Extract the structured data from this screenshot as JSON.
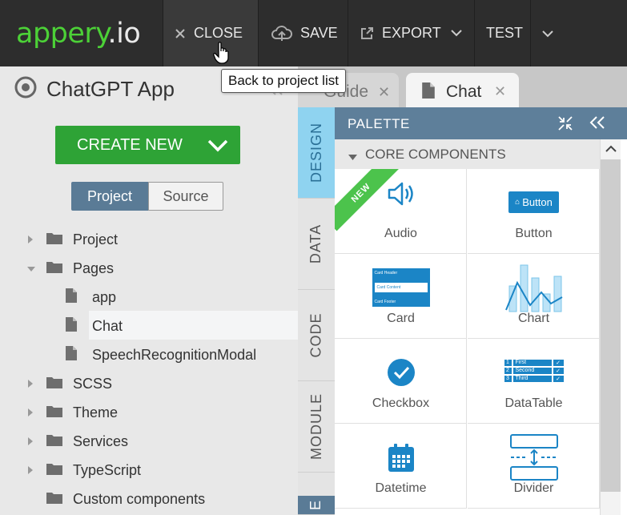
{
  "app": {
    "logo_main": "appery",
    "logo_suffix": ".io",
    "accent": "#4cd137"
  },
  "toolbar": {
    "close_label": "CLOSE",
    "save_label": "SAVE",
    "export_label": "EXPORT",
    "test_label": "TEST"
  },
  "tooltip": {
    "text": "Back to project list"
  },
  "project": {
    "title": "ChatGPT App"
  },
  "create_button": {
    "label": "CREATE NEW"
  },
  "view_toggle": {
    "project": "Project",
    "source": "Source"
  },
  "tree": {
    "items": [
      {
        "label": "Project"
      },
      {
        "label": "Pages"
      },
      {
        "label": "app"
      },
      {
        "label": "Chat"
      },
      {
        "label": "SpeechRecognitionModal"
      },
      {
        "label": "SCSS"
      },
      {
        "label": "Theme"
      },
      {
        "label": "Services"
      },
      {
        "label": "TypeScript"
      },
      {
        "label": "Custom components"
      }
    ]
  },
  "tabs": {
    "guide": "Guide",
    "chat": "Chat"
  },
  "side_tabs": {
    "design": "DESIGN",
    "data": "DATA",
    "code": "CODE",
    "module": "MODULE",
    "last": "E"
  },
  "palette": {
    "title": "PALETTE",
    "section": "CORE COMPONENTS",
    "new_badge": "NEW",
    "components": [
      {
        "label": "Audio",
        "icon": "speaker-icon"
      },
      {
        "label": "Button",
        "icon": "button-preview",
        "preview_text": "Button"
      },
      {
        "label": "Card",
        "icon": "card-preview",
        "lines": [
          "Card Header",
          "Card Content",
          "Card Footer"
        ]
      },
      {
        "label": "Chart",
        "icon": "chart-icon"
      },
      {
        "label": "Checkbox",
        "icon": "checkbox-icon"
      },
      {
        "label": "DataTable",
        "icon": "datatable-icon",
        "rows": [
          [
            "1",
            "First"
          ],
          [
            "2",
            "Second"
          ],
          [
            "3",
            "Third"
          ]
        ]
      },
      {
        "label": "Datetime",
        "icon": "calendar-icon"
      },
      {
        "label": "Divider",
        "icon": "divider-icon"
      }
    ]
  }
}
